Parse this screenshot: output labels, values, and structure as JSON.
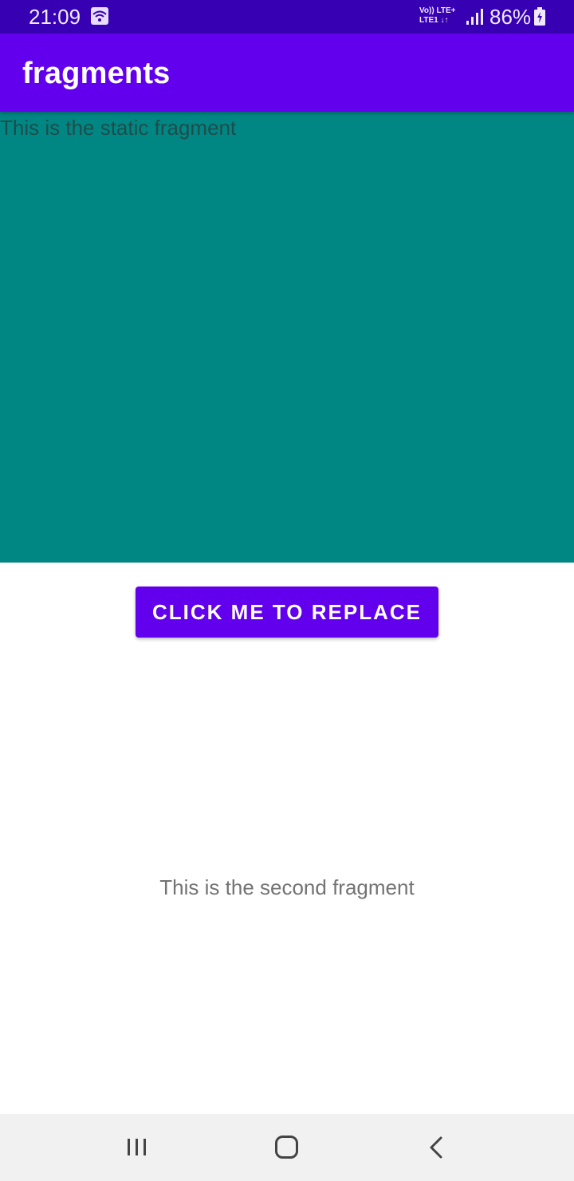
{
  "status_bar": {
    "time": "21:09",
    "network_line1": "Vo)) LTE+",
    "network_line2": "LTE1 ↓↑",
    "battery": "86%",
    "icons": [
      "wifi-icon",
      "signal-icon",
      "battery-icon"
    ]
  },
  "app_bar": {
    "title": "fragments"
  },
  "static_fragment": {
    "text": "This is the static fragment",
    "background": "#008784"
  },
  "replace_button": {
    "label": "CLICK ME TO REPLACE",
    "color": "#6200EE"
  },
  "second_fragment": {
    "text": "This is the second fragment"
  },
  "nav_bar": {
    "icons": [
      "recents-icon",
      "home-icon",
      "back-icon"
    ]
  },
  "colors": {
    "status_bar": "#3700B3",
    "primary": "#6200EE",
    "nav_bar": "#F1F1F1"
  }
}
